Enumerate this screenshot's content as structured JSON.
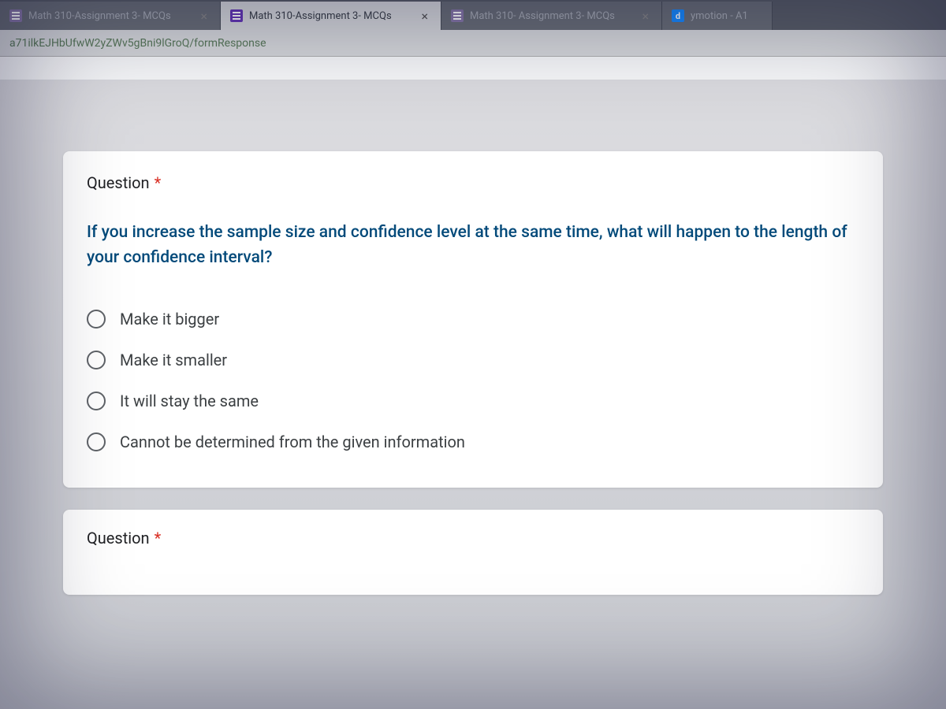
{
  "tabs": [
    {
      "title": "Math 310-Assignment 3- MCQs",
      "icon": "forms-faded",
      "active": false,
      "close": "×"
    },
    {
      "title": "Math 310-Assignment 3- MCQs",
      "icon": "forms",
      "active": true,
      "close": "×"
    },
    {
      "title": "Math 310- Assignment 3- MCQs",
      "icon": "forms-faded",
      "active": false,
      "close": "×"
    },
    {
      "title": "ymotion - A1",
      "icon": "d",
      "active": false,
      "close": ""
    }
  ],
  "url_fragment": "a71ilkEJHbUfwW2yZWv5gBni9lGroQ/formResponse",
  "question": {
    "label": "Question",
    "required_marker": "*",
    "text": "If you increase the sample size and confidence level at the same time, what will happen to the length of your confidence interval?",
    "options": [
      "Make it bigger",
      "Make it smaller",
      "It will stay the same",
      "Cannot be determined from the given information"
    ]
  },
  "next_question": {
    "label": "Question",
    "required_marker": "*"
  }
}
